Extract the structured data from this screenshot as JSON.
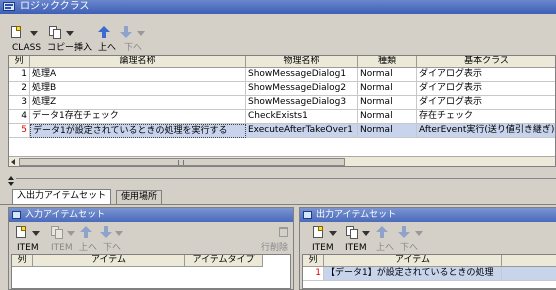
{
  "window": {
    "title": "ロジッククラス"
  },
  "toolbar": {
    "labels": [
      "CLASS",
      "コピー挿入",
      "上へ",
      "下へ"
    ]
  },
  "table": {
    "columns": [
      "列",
      "論理名称",
      "物理名称",
      "種類",
      "基本クラス"
    ],
    "rows": [
      {
        "num": "1",
        "logical": "処理A",
        "physical": "ShowMessageDialog1",
        "kind": "Normal",
        "base": "ダイアログ表示"
      },
      {
        "num": "2",
        "logical": "処理B",
        "physical": "ShowMessageDialog2",
        "kind": "Normal",
        "base": "ダイアログ表示"
      },
      {
        "num": "3",
        "logical": "処理Z",
        "physical": "ShowMessageDialog3",
        "kind": "Normal",
        "base": "ダイアログ表示"
      },
      {
        "num": "4",
        "logical": "データ1存在チェック",
        "physical": "CheckExists1",
        "kind": "Normal",
        "base": "存在チェック"
      },
      {
        "num": "5",
        "logical": "データ1が設定されているときの処理を実行する",
        "physical": "ExecuteAfterTakeOver1",
        "kind": "Normal",
        "base": "AfterEvent実行(送り値引き継ぎ)"
      }
    ],
    "selected_row": 5
  },
  "tabs": [
    "入出力アイテムセット",
    "使用場所"
  ],
  "input_panel": {
    "title": "入力アイテムセット",
    "toolbar": [
      "ITEM",
      "ITEM",
      "上へ",
      "下へ",
      "行削除"
    ],
    "columns": [
      "列",
      "アイテム",
      "アイテムタイプ"
    ]
  },
  "output_panel": {
    "title": "出力アイテムセット",
    "toolbar": [
      "ITEM",
      "ITEM",
      "上へ",
      "下へ"
    ],
    "columns": [
      "列",
      "アイテム"
    ],
    "rows": [
      {
        "num": "1",
        "item": "【データ1】が設定されているときの処理"
      }
    ]
  },
  "colors": {
    "title_bar": "#3d5fb5",
    "selection": "#c7d4ec",
    "selected_row_number": "#dd0000"
  }
}
